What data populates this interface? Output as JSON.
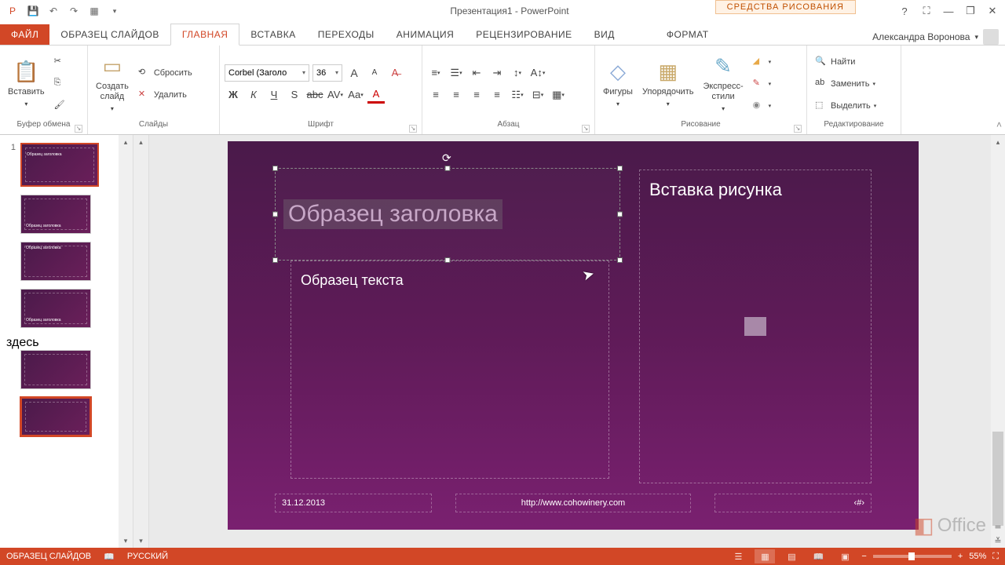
{
  "app": {
    "title": "Презентация1 - PowerPoint",
    "contextual_tools": "СРЕДСТВА РИСОВАНИЯ"
  },
  "user": {
    "name": "Александра Воронова"
  },
  "qat": {
    "save": "💾",
    "undo": "↶",
    "redo": "↷",
    "start": "▦"
  },
  "tabs": {
    "file": "ФАЙЛ",
    "items": [
      "ОБРАЗЕЦ СЛАЙДОВ",
      "ГЛАВНАЯ",
      "ВСТАВКА",
      "ПЕРЕХОДЫ",
      "АНИМАЦИЯ",
      "РЕЦЕНЗИРОВАНИЕ",
      "ВИД"
    ],
    "format": "ФОРМАТ",
    "active_index": 1
  },
  "ribbon": {
    "clipboard": {
      "label": "Буфер обмена",
      "paste": "Вставить"
    },
    "slides": {
      "label": "Слайды",
      "new": "Создать\nслайд",
      "reset": "Сбросить",
      "delete": "Удалить"
    },
    "font": {
      "label": "Шрифт",
      "name": "Corbel (Заголо",
      "size": "36"
    },
    "paragraph": {
      "label": "Абзац"
    },
    "drawing": {
      "label": "Рисование",
      "shapes": "Фигуры",
      "arrange": "Упорядочить",
      "styles": "Экспресс-\nстили"
    },
    "editing": {
      "label": "Редактирование",
      "find": "Найти",
      "replace": "Заменить",
      "select": "Выделить"
    }
  },
  "slide": {
    "title_placeholder": "Образец заголовка",
    "body_placeholder": "Образец текста",
    "picture_placeholder": "Вставка рисунка",
    "date": "31.12.2013",
    "footer": "http://www.cohowinery.com",
    "number": "‹#›"
  },
  "status": {
    "mode": "ОБРАЗЕЦ СЛАЙДОВ",
    "lang": "РУССКИЙ",
    "zoom": "55%"
  },
  "watermark": "Office"
}
